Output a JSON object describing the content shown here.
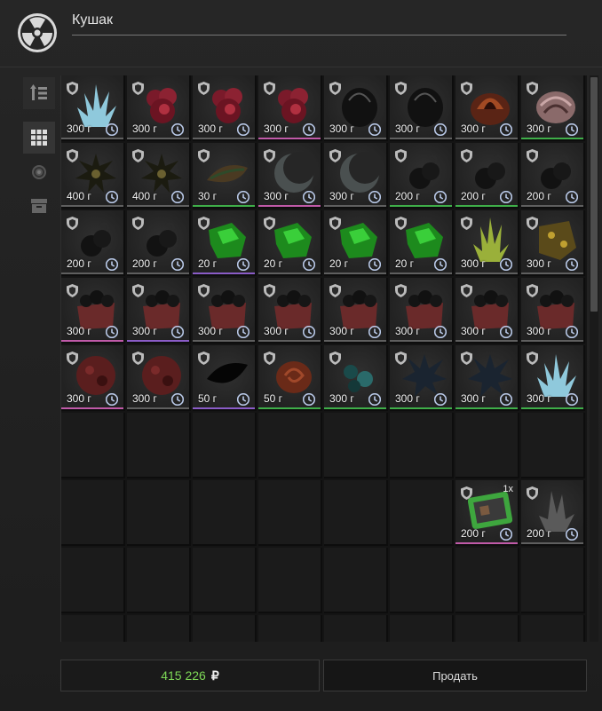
{
  "header": {
    "title": "Кушак"
  },
  "sidebar": {
    "buttons": [
      {
        "name": "sort-icon"
      },
      {
        "name": "grid-view-icon"
      },
      {
        "name": "artifact-filter-icon"
      },
      {
        "name": "container-filter-icon"
      }
    ]
  },
  "colors": {
    "rarity_purple": "#8a5cc7",
    "rarity_green": "#3fae49",
    "rarity_pink": "#c05aa8",
    "money": "#7ed957"
  },
  "grid": {
    "rows": [
      [
        {
          "price": "300 г",
          "art": "crystal-blue",
          "rarity": "none"
        },
        {
          "price": "300 г",
          "art": "red-flower",
          "rarity": "none"
        },
        {
          "price": "300 г",
          "art": "red-flower",
          "rarity": "none"
        },
        {
          "price": "300 г",
          "art": "red-flower",
          "rarity": "pink"
        },
        {
          "price": "300 г",
          "art": "black-stone",
          "rarity": "none"
        },
        {
          "price": "300 г",
          "art": "black-stone",
          "rarity": "none"
        },
        {
          "price": "300 г",
          "art": "orange-shell",
          "rarity": "none"
        },
        {
          "price": "300 г",
          "art": "pink-shell",
          "rarity": "green"
        }
      ],
      [
        {
          "price": "400 г",
          "art": "spiky-black",
          "rarity": "none"
        },
        {
          "price": "400 г",
          "art": "spiky-black",
          "rarity": "none"
        },
        {
          "price": "30 г",
          "art": "leaf-brown",
          "rarity": "green"
        },
        {
          "price": "300 г",
          "art": "moon-grey",
          "rarity": "pink"
        },
        {
          "price": "300 г",
          "art": "moon-grey",
          "rarity": "none"
        },
        {
          "price": "200 г",
          "art": "black-cluster",
          "rarity": "green"
        },
        {
          "price": "200 г",
          "art": "black-cluster",
          "rarity": "green"
        },
        {
          "price": "200 г",
          "art": "black-cluster",
          "rarity": "none"
        }
      ],
      [
        {
          "price": "200 г",
          "art": "black-cluster",
          "rarity": "none"
        },
        {
          "price": "200 г",
          "art": "black-cluster",
          "rarity": "none"
        },
        {
          "price": "20 г",
          "art": "green-gem",
          "rarity": "purple"
        },
        {
          "price": "20 г",
          "art": "green-gem",
          "rarity": "none"
        },
        {
          "price": "20 г",
          "art": "green-gem",
          "rarity": "none"
        },
        {
          "price": "20 г",
          "art": "green-gem",
          "rarity": "none"
        },
        {
          "price": "300 г",
          "art": "yellow-crystal",
          "rarity": "none"
        },
        {
          "price": "300 г",
          "art": "gold-rock",
          "rarity": "none"
        }
      ],
      [
        {
          "price": "300 г",
          "art": "coal-chest",
          "rarity": "pink"
        },
        {
          "price": "300 г",
          "art": "coal-chest",
          "rarity": "purple"
        },
        {
          "price": "300 г",
          "art": "coal-chest",
          "rarity": "none"
        },
        {
          "price": "300 г",
          "art": "coal-chest",
          "rarity": "none"
        },
        {
          "price": "300 г",
          "art": "coal-chest",
          "rarity": "none"
        },
        {
          "price": "300 г",
          "art": "coal-chest",
          "rarity": "none"
        },
        {
          "price": "300 г",
          "art": "coal-chest",
          "rarity": "none"
        },
        {
          "price": "300 г",
          "art": "coal-chest",
          "rarity": "none"
        }
      ],
      [
        {
          "price": "300 г",
          "art": "red-orb",
          "rarity": "pink"
        },
        {
          "price": "300 г",
          "art": "red-orb",
          "rarity": "none"
        },
        {
          "price": "50 г",
          "art": "black-shard",
          "rarity": "purple"
        },
        {
          "price": "50 г",
          "art": "spiral-shell",
          "rarity": "green"
        },
        {
          "price": "300 г",
          "art": "teal-crystals",
          "rarity": "green"
        },
        {
          "price": "300 г",
          "art": "dark-spikes",
          "rarity": "green"
        },
        {
          "price": "300 г",
          "art": "dark-spikes",
          "rarity": "green"
        },
        {
          "price": "300 г",
          "art": "crystal-blue",
          "rarity": "green"
        }
      ],
      [
        null,
        null,
        null,
        null,
        null,
        null,
        null,
        null
      ],
      [
        null,
        null,
        null,
        null,
        null,
        null,
        {
          "price": "200 г",
          "art": "green-container",
          "rarity": "pink",
          "count": "1x"
        },
        {
          "price": "200 г",
          "art": "grey-crystal",
          "rarity": "none"
        }
      ],
      [
        null,
        null,
        null,
        null,
        null,
        null,
        null,
        null
      ],
      [
        null,
        null,
        null,
        null,
        null,
        null,
        null,
        null
      ]
    ]
  },
  "footer": {
    "money_value": "415 226",
    "money_currency": "₽",
    "sell_label": "Продать"
  }
}
